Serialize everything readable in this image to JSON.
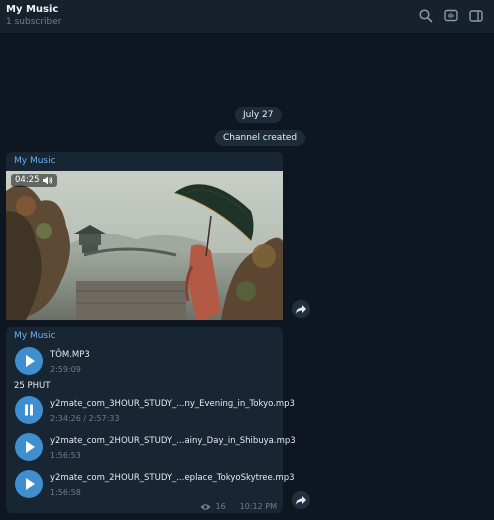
{
  "header": {
    "title": "My Music",
    "subtitle": "1 subscriber",
    "icons": [
      "search-icon",
      "live-stream-icon",
      "sidebar-toggle-icon"
    ]
  },
  "service": {
    "date": "July 27",
    "event": "Channel created"
  },
  "messages": [
    {
      "sender": "My Music",
      "video": {
        "duration": "04:25",
        "icon": "speaker-icon"
      }
    },
    {
      "sender": "My Music",
      "tracks": [
        {
          "title": "TÔM.MP3",
          "meta": "2:59:09",
          "state": "play"
        },
        {
          "title": "y2mate_com_3HOUR_STUDY_...ny_Evening_in_Tokyo.mp3",
          "meta": "2:34:26 / 2:57:33",
          "state": "pause"
        },
        {
          "title": "y2mate_com_2HOUR_STUDY_...ainy_Day_in_Shibuya.mp3",
          "meta": "1:56:53",
          "state": "play"
        },
        {
          "title": "y2mate_com_2HOUR_STUDY_...eplace_TokyoSkytree.mp3",
          "meta": "1:56:58",
          "state": "play"
        }
      ],
      "caption": "25 PHUT",
      "views": "16",
      "time": "10:12 PM"
    }
  ],
  "colors": {
    "background": "#0e1621",
    "header": "#17212b",
    "bubble": "#182533",
    "accent": "#3e8ed0",
    "sender": "#6ab3f3"
  }
}
